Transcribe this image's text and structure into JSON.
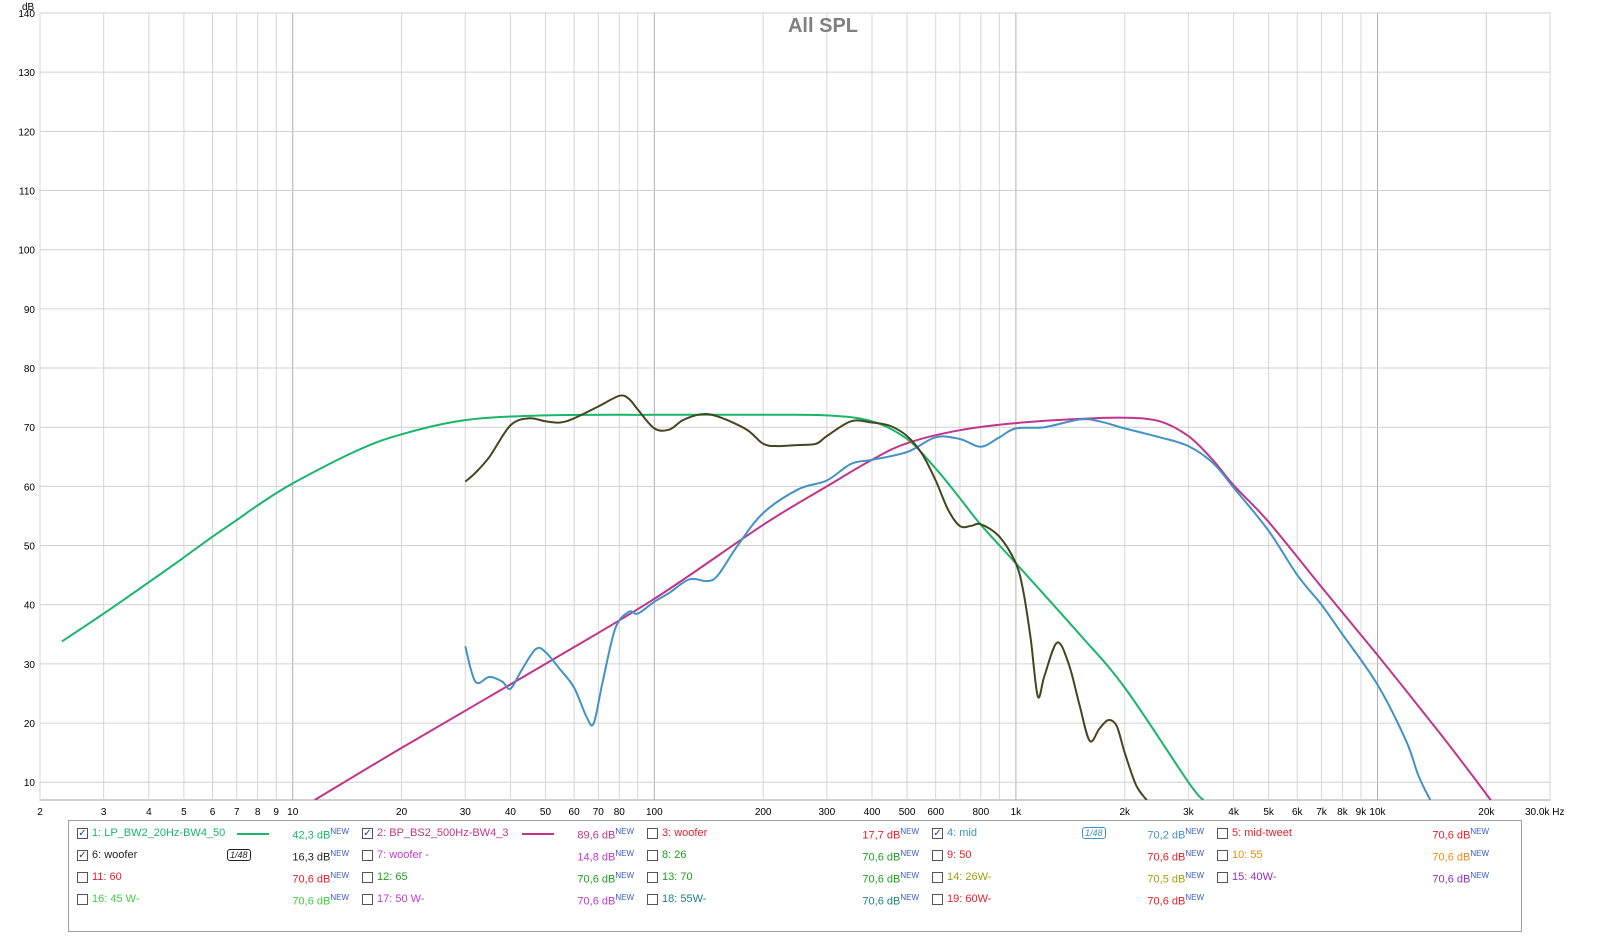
{
  "chart_data": {
    "type": "line",
    "title": "All SPL",
    "ylabel": "dB",
    "xunit": "Hz",
    "xscale": "log",
    "xlim": [
      2,
      30000
    ],
    "ylim": [
      7,
      140
    ],
    "grid": true,
    "y_ticks": [
      "10",
      "20",
      "30",
      "40",
      "50",
      "60",
      "70",
      "80",
      "90",
      "100",
      "110",
      "120",
      "130",
      "140"
    ],
    "x_tick_labels": [
      {
        "v": 2,
        "t": "2"
      },
      {
        "v": 3,
        "t": "3"
      },
      {
        "v": 4,
        "t": "4"
      },
      {
        "v": 5,
        "t": "5"
      },
      {
        "v": 6,
        "t": "6"
      },
      {
        "v": 7,
        "t": "7"
      },
      {
        "v": 8,
        "t": "8"
      },
      {
        "v": 9,
        "t": "9"
      },
      {
        "v": 10,
        "t": "10"
      },
      {
        "v": 20,
        "t": "20"
      },
      {
        "v": 30,
        "t": "30"
      },
      {
        "v": 40,
        "t": "40"
      },
      {
        "v": 50,
        "t": "50"
      },
      {
        "v": 60,
        "t": "60"
      },
      {
        "v": 70,
        "t": "70"
      },
      {
        "v": 80,
        "t": "80"
      },
      {
        "v": 100,
        "t": "100"
      },
      {
        "v": 200,
        "t": "200"
      },
      {
        "v": 300,
        "t": "300"
      },
      {
        "v": 400,
        "t": "400"
      },
      {
        "v": 500,
        "t": "500"
      },
      {
        "v": 600,
        "t": "600"
      },
      {
        "v": 800,
        "t": "800"
      },
      {
        "v": 1000,
        "t": "1k"
      },
      {
        "v": 2000,
        "t": "2k"
      },
      {
        "v": 3000,
        "t": "3k"
      },
      {
        "v": 4000,
        "t": "4k"
      },
      {
        "v": 5000,
        "t": "5k"
      },
      {
        "v": 6000,
        "t": "6k"
      },
      {
        "v": 7000,
        "t": "7k"
      },
      {
        "v": 8000,
        "t": "8k"
      },
      {
        "v": 9000,
        "t": "9k"
      },
      {
        "v": 10000,
        "t": "10k"
      },
      {
        "v": 20000,
        "t": "20k"
      },
      {
        "v": 30000,
        "t": "30,0k Hz"
      }
    ],
    "series": [
      {
        "name": "LP_BW2_20Hz-BW4_50",
        "color": "#19b56a",
        "points": [
          [
            2.3,
            33.8
          ],
          [
            3,
            38.5
          ],
          [
            4,
            43.8
          ],
          [
            5,
            48
          ],
          [
            6,
            51.5
          ],
          [
            7,
            54.3
          ],
          [
            8,
            56.8
          ],
          [
            10,
            60.5
          ],
          [
            15,
            66
          ],
          [
            20,
            68.8
          ],
          [
            30,
            71.2
          ],
          [
            50,
            72
          ],
          [
            100,
            72.1
          ],
          [
            200,
            72.1
          ],
          [
            300,
            72
          ],
          [
            400,
            71
          ],
          [
            500,
            68
          ],
          [
            600,
            63
          ],
          [
            700,
            58
          ],
          [
            800,
            53.5
          ],
          [
            1000,
            47
          ],
          [
            1500,
            35
          ],
          [
            2000,
            26
          ],
          [
            3000,
            10
          ],
          [
            3300,
            7
          ]
        ]
      },
      {
        "name": "BP_BS2_500Hz-BW4_3",
        "color": "#c0358a",
        "points": [
          [
            11.5,
            7
          ],
          [
            20,
            15.8
          ],
          [
            50,
            30
          ],
          [
            100,
            41
          ],
          [
            200,
            53.5
          ],
          [
            300,
            60
          ],
          [
            400,
            64.5
          ],
          [
            500,
            67.3
          ],
          [
            700,
            69.5
          ],
          [
            1000,
            70.7
          ],
          [
            1500,
            71.4
          ],
          [
            2000,
            71.6
          ],
          [
            2500,
            71
          ],
          [
            3000,
            68.5
          ],
          [
            3500,
            64.5
          ],
          [
            4000,
            60.2
          ],
          [
            5000,
            54
          ],
          [
            7000,
            43
          ],
          [
            10000,
            31.5
          ],
          [
            15000,
            18
          ],
          [
            20000,
            8
          ],
          [
            20500,
            7
          ]
        ]
      },
      {
        "name": "mid",
        "color": "#4392c6",
        "points": [
          [
            30,
            33
          ],
          [
            32,
            27
          ],
          [
            35,
            27.8
          ],
          [
            38,
            27
          ],
          [
            40,
            25.8
          ],
          [
            43,
            29
          ],
          [
            47,
            32.5
          ],
          [
            50,
            32
          ],
          [
            55,
            29
          ],
          [
            60,
            26
          ],
          [
            65,
            21
          ],
          [
            68,
            20
          ],
          [
            72,
            27
          ],
          [
            78,
            36
          ],
          [
            85,
            38.8
          ],
          [
            90,
            38.5
          ],
          [
            100,
            40.5
          ],
          [
            110,
            42
          ],
          [
            125,
            44.3
          ],
          [
            140,
            44
          ],
          [
            150,
            45
          ],
          [
            170,
            50
          ],
          [
            200,
            55.5
          ],
          [
            250,
            59.5
          ],
          [
            300,
            61
          ],
          [
            350,
            63.8
          ],
          [
            400,
            64.5
          ],
          [
            500,
            65.8
          ],
          [
            600,
            68.3
          ],
          [
            700,
            68
          ],
          [
            800,
            66.7
          ],
          [
            900,
            68.3
          ],
          [
            1000,
            69.8
          ],
          [
            1200,
            70
          ],
          [
            1500,
            71.3
          ],
          [
            1700,
            71
          ],
          [
            2000,
            69.8
          ],
          [
            2500,
            68.3
          ],
          [
            3000,
            66.8
          ],
          [
            3500,
            64
          ],
          [
            4000,
            59.8
          ],
          [
            5000,
            52.5
          ],
          [
            6000,
            45
          ],
          [
            7000,
            40
          ],
          [
            8000,
            35
          ],
          [
            10000,
            26.5
          ],
          [
            12000,
            17
          ],
          [
            13000,
            11
          ],
          [
            14000,
            7
          ]
        ]
      },
      {
        "name": "woofer",
        "color": "#45461f",
        "points": [
          [
            30,
            60.8
          ],
          [
            32,
            62.3
          ],
          [
            35,
            65
          ],
          [
            40,
            70.3
          ],
          [
            45,
            71.5
          ],
          [
            50,
            71
          ],
          [
            55,
            70.8
          ],
          [
            60,
            71.5
          ],
          [
            70,
            73.5
          ],
          [
            80,
            75.3
          ],
          [
            85,
            74.8
          ],
          [
            90,
            73
          ],
          [
            100,
            69.8
          ],
          [
            110,
            69.6
          ],
          [
            120,
            71.2
          ],
          [
            135,
            72.2
          ],
          [
            150,
            71.8
          ],
          [
            180,
            69.6
          ],
          [
            200,
            67.2
          ],
          [
            220,
            66.8
          ],
          [
            250,
            67
          ],
          [
            280,
            67.2
          ],
          [
            300,
            68.5
          ],
          [
            350,
            71
          ],
          [
            400,
            70.8
          ],
          [
            450,
            70.2
          ],
          [
            500,
            68.5
          ],
          [
            550,
            65.5
          ],
          [
            600,
            61
          ],
          [
            650,
            56
          ],
          [
            700,
            53.3
          ],
          [
            750,
            53.3
          ],
          [
            800,
            53.6
          ],
          [
            900,
            51.5
          ],
          [
            1000,
            47
          ],
          [
            1050,
            42
          ],
          [
            1100,
            34
          ],
          [
            1150,
            24.5
          ],
          [
            1200,
            28
          ],
          [
            1300,
            33.6
          ],
          [
            1400,
            30
          ],
          [
            1500,
            23
          ],
          [
            1600,
            17
          ],
          [
            1700,
            19
          ],
          [
            1800,
            20.5
          ],
          [
            1900,
            19.5
          ],
          [
            2000,
            15
          ],
          [
            2150,
            9.5
          ],
          [
            2300,
            7
          ]
        ]
      }
    ]
  },
  "legend": {
    "items": [
      {
        "label": "1: LP_BW2_20Hz-BW4_50",
        "color": "#19b56a",
        "checked": true,
        "db": "42,3 dB",
        "sup": "NEW",
        "swatch": "line"
      },
      {
        "label": "2: BP_BS2_500Hz-BW4_3",
        "color": "#c0358a",
        "checked": true,
        "db": "89,6 dB",
        "sup": "NEW",
        "swatch": "line"
      },
      {
        "label": "3: woofer",
        "color": "#e8202a",
        "checked": false,
        "db": "17,7 dB",
        "sup": "NEW",
        "swatch": ""
      },
      {
        "label": "4: mid",
        "color": "#4392c6",
        "checked": true,
        "db": "70,2 dB",
        "sup": "NEW",
        "swatch": "smooth",
        "smoothing": "1/48"
      },
      {
        "label": "5: mid-tweet",
        "color": "#e8202a",
        "checked": false,
        "db": "70,6 dB",
        "sup": "NEW",
        "swatch": ""
      },
      {
        "label": "6: woofer",
        "color": "#222222",
        "checked": true,
        "db": "16,3 dB",
        "sup": "NEW",
        "swatch": "smooth",
        "smoothing": "1/48"
      },
      {
        "label": "7: woofer -",
        "color": "#c03ad0",
        "checked": false,
        "db": "14,8 dB",
        "sup": "NEW",
        "swatch": ""
      },
      {
        "label": "8: 26",
        "color": "#1fa01f",
        "checked": false,
        "db": "70,6 dB",
        "sup": "NEW",
        "swatch": ""
      },
      {
        "label": "9: 50",
        "color": "#e8202a",
        "checked": false,
        "db": "70,6 dB",
        "sup": "NEW",
        "swatch": ""
      },
      {
        "label": "10: 55",
        "color": "#f08a10",
        "checked": false,
        "db": "70,6 dB",
        "sup": "NEW",
        "swatch": ""
      },
      {
        "label": "11: 60",
        "color": "#e8202a",
        "checked": false,
        "db": "70,6 dB",
        "sup": "NEW",
        "swatch": ""
      },
      {
        "label": "12: 65",
        "color": "#1fa01f",
        "checked": false,
        "db": "70,6 dB",
        "sup": "NEW",
        "swatch": ""
      },
      {
        "label": "13: 70",
        "color": "#1fa01f",
        "checked": false,
        "db": "70,6 dB",
        "sup": "NEW",
        "swatch": ""
      },
      {
        "label": "14: 26W-",
        "color": "#a0a010",
        "checked": false,
        "db": "70,5 dB",
        "sup": "NEW",
        "swatch": ""
      },
      {
        "label": "15: 40W-",
        "color": "#9030c0",
        "checked": false,
        "db": "70,6 dB",
        "sup": "NEW",
        "swatch": ""
      },
      {
        "label": "16: 45 W-",
        "color": "#40d040",
        "checked": false,
        "db": "70,6 dB",
        "sup": "NEW",
        "swatch": ""
      },
      {
        "label": "17: 50 W-",
        "color": "#c03ad0",
        "checked": false,
        "db": "70,6 dB",
        "sup": "NEW",
        "swatch": ""
      },
      {
        "label": "18: 55W-",
        "color": "#20808a",
        "checked": false,
        "db": "70,6 dB",
        "sup": "NEW",
        "swatch": ""
      },
      {
        "label": "19: 60W-",
        "color": "#e8202a",
        "checked": false,
        "db": "70,6 dB",
        "sup": "NEW",
        "swatch": ""
      }
    ]
  }
}
